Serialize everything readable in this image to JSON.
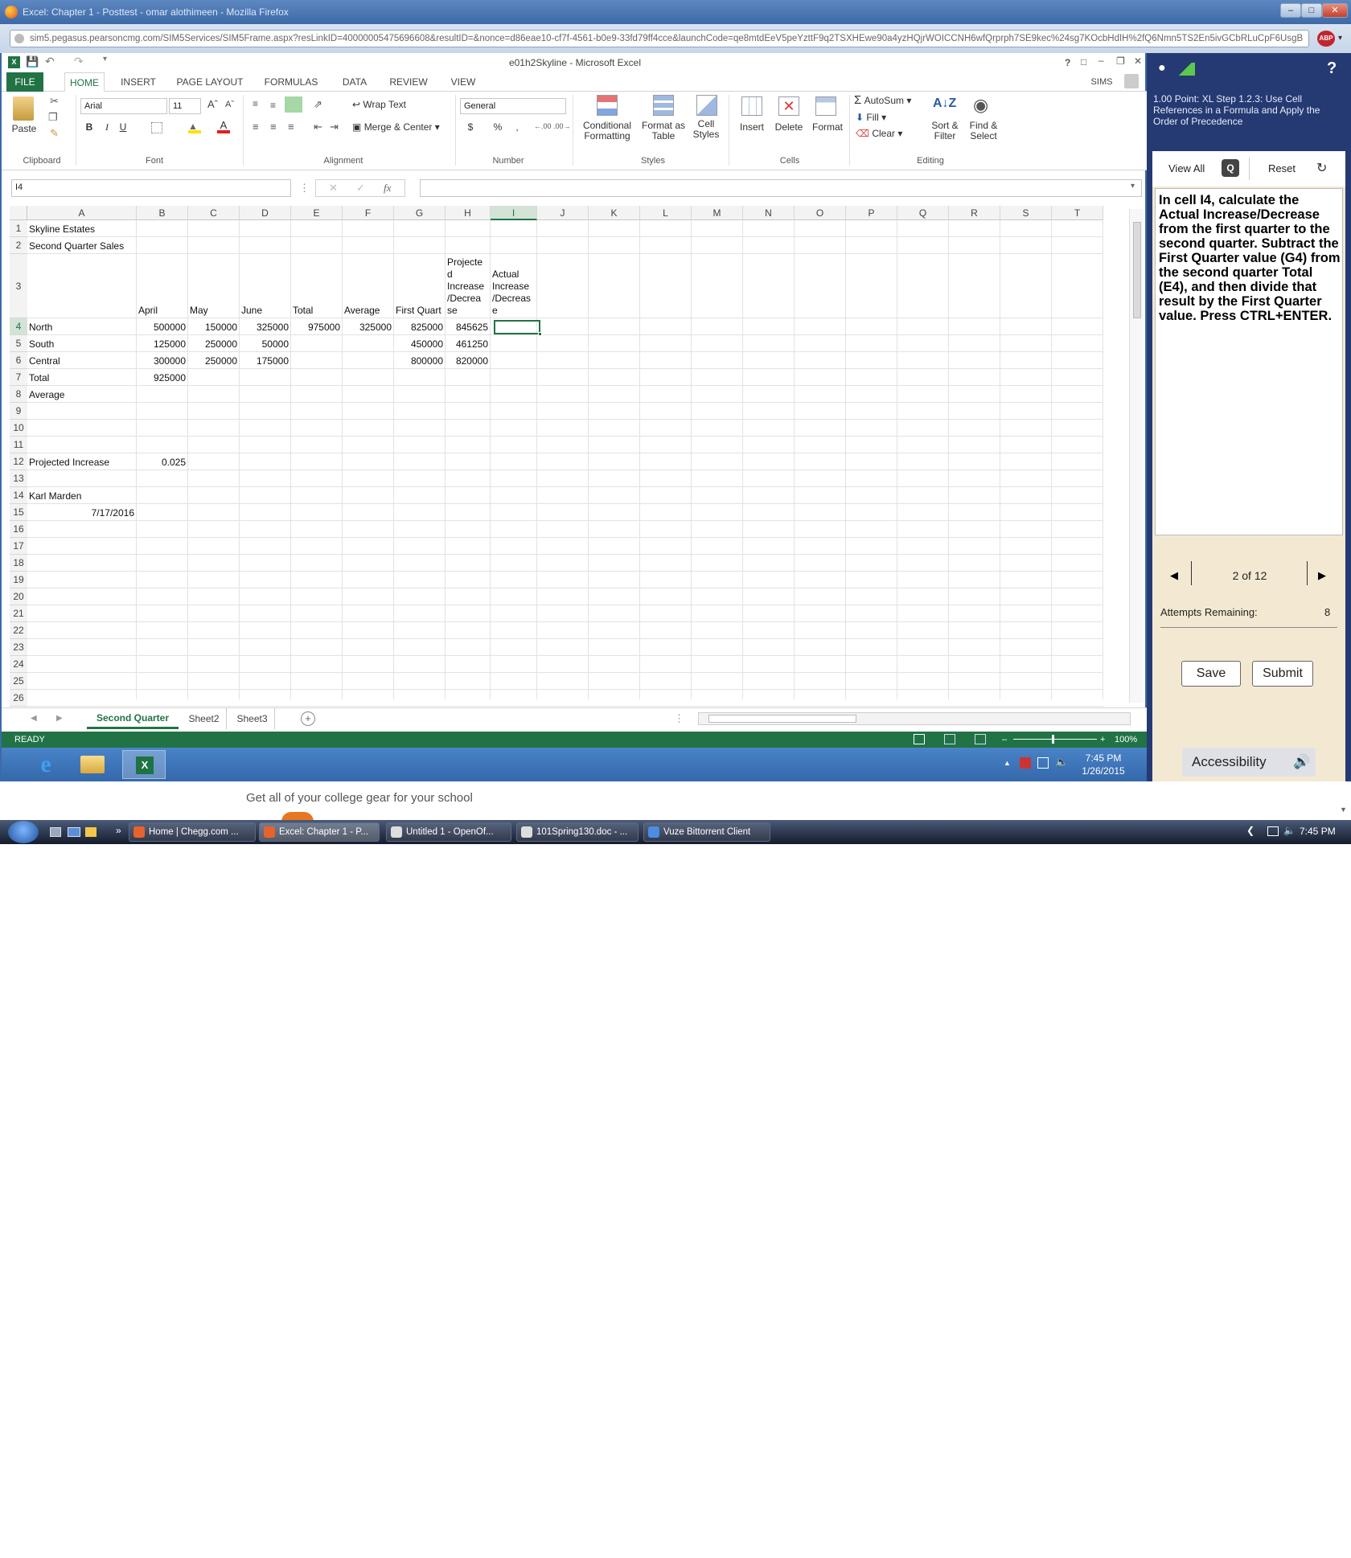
{
  "browser": {
    "title": "Excel: Chapter 1 - Posttest - omar alothimeen - Mozilla Firefox",
    "url": "sim5.pegasus.pearsoncmg.com/SIM5Services/SIM5Frame.aspx?resLinkID=40000005475696608&resultID=&nonce=d86eae10-cf7f-4561-b0e9-33fd79ff4cce&launchCode=qe8mtdEeV5peYzttF9q2TSXHEwe90a4yzHQjrWOICCNH6wfQrprph7SE9kec%24sg7KOcbHdIH%2fQ6Nmn5TS2En5ivGCbRLuCpF6UsgB"
  },
  "excel": {
    "title": "e01h2Skyline - Microsoft Excel",
    "help": "?",
    "user": "SIMS",
    "tabs": [
      "FILE",
      "HOME",
      "INSERT",
      "PAGE LAYOUT",
      "FORMULAS",
      "DATA",
      "REVIEW",
      "VIEW"
    ],
    "ribbon": {
      "paste": "Paste",
      "font_name": "Arial",
      "font_size": "11",
      "bold": "B",
      "italic": "I",
      "underline": "U",
      "wrap_text": "Wrap Text",
      "merge_center": "Merge & Center",
      "number_format": "General",
      "currency": "$",
      "percent": "%",
      "comma": ",",
      "conditional_formatting": "Conditional Formatting",
      "format_as_table": "Format as Table",
      "cell_styles": "Cell Styles",
      "insert": "Insert",
      "delete": "Delete",
      "format": "Format",
      "autosum": "AutoSum",
      "fill": "Fill",
      "clear": "Clear",
      "sort_filter": "Sort & Filter",
      "find_select": "Find & Select",
      "groups": [
        "Clipboard",
        "Font",
        "Alignment",
        "Number",
        "Styles",
        "Cells",
        "Editing"
      ]
    },
    "name_box": "I4",
    "fx": "fx",
    "columns": [
      "A",
      "B",
      "C",
      "D",
      "E",
      "F",
      "G",
      "H",
      "I",
      "J",
      "K",
      "L",
      "M",
      "N",
      "O",
      "P",
      "Q",
      "R",
      "S",
      "T"
    ],
    "rows": [
      "1",
      "2",
      "3",
      "4",
      "5",
      "6",
      "7",
      "8",
      "9",
      "10",
      "11",
      "12",
      "13",
      "14",
      "15",
      "16",
      "17",
      "18",
      "19",
      "20",
      "21",
      "22",
      "23",
      "24",
      "25",
      "26"
    ],
    "cells": {
      "A1": "Skyline Estates",
      "A2": "Second Quarter Sales",
      "B3": "April",
      "C3": "May",
      "D3": "June",
      "E3": "Total",
      "F3": "Average",
      "G3": "First Quart",
      "H3": [
        "Projecte",
        "d",
        "Increase",
        "/Decrea",
        "se"
      ],
      "I3": [
        "Actual",
        "Increase",
        "/Decreas",
        "e"
      ],
      "A4": "North",
      "B4": "500000",
      "C4": "150000",
      "D4": "325000",
      "E4": "975000",
      "F4": "325000",
      "G4": "825000",
      "H4": "845625",
      "A5": "South",
      "B5": "125000",
      "C5": "250000",
      "D5": "50000",
      "G5": "450000",
      "H5": "461250",
      "A6": "Central",
      "B6": "300000",
      "C6": "250000",
      "D6": "175000",
      "G6": "800000",
      "H6": "820000",
      "A7": "Total",
      "B7": "925000",
      "A8": "Average",
      "A12": "Projected Increase",
      "B12": "0.025",
      "A14": "Karl Marden",
      "A15": "7/17/2016"
    },
    "sheets": [
      "Second Quarter",
      "Sheet2",
      "Sheet3"
    ],
    "status": "READY",
    "zoom": "100%",
    "clock_time": "7:45 PM",
    "clock_date": "1/26/2015"
  },
  "sims": {
    "step_title": "1.00 Point: XL Step 1.2.3: Use Cell References in a Formula and Apply the Order of Precedence",
    "help": "?",
    "view_all": "View All",
    "reset": "Reset",
    "instructions": "In cell I4, calculate the Actual Increase/Decrease from the first quarter to the second quarter. Subtract the First Quarter value (G4) from the second quarter Total (E4), and then divide that result by the First Quarter value. Press CTRL+ENTER.",
    "pager": "2 of 12",
    "attempts_label": "Attempts Remaining:",
    "attempts_value": "8",
    "save": "Save",
    "submit": "Submit",
    "accessibility": "Accessibility"
  },
  "ad_text": "Get all of your college gear for your school",
  "taskbar": {
    "items": [
      "Home | Chegg.com ...",
      "Excel: Chapter 1 - P...",
      "Untitled 1 - OpenOf...",
      "101Spring130.doc - ...",
      "Vuze Bittorrent Client"
    ],
    "time": "7:45 PM"
  }
}
